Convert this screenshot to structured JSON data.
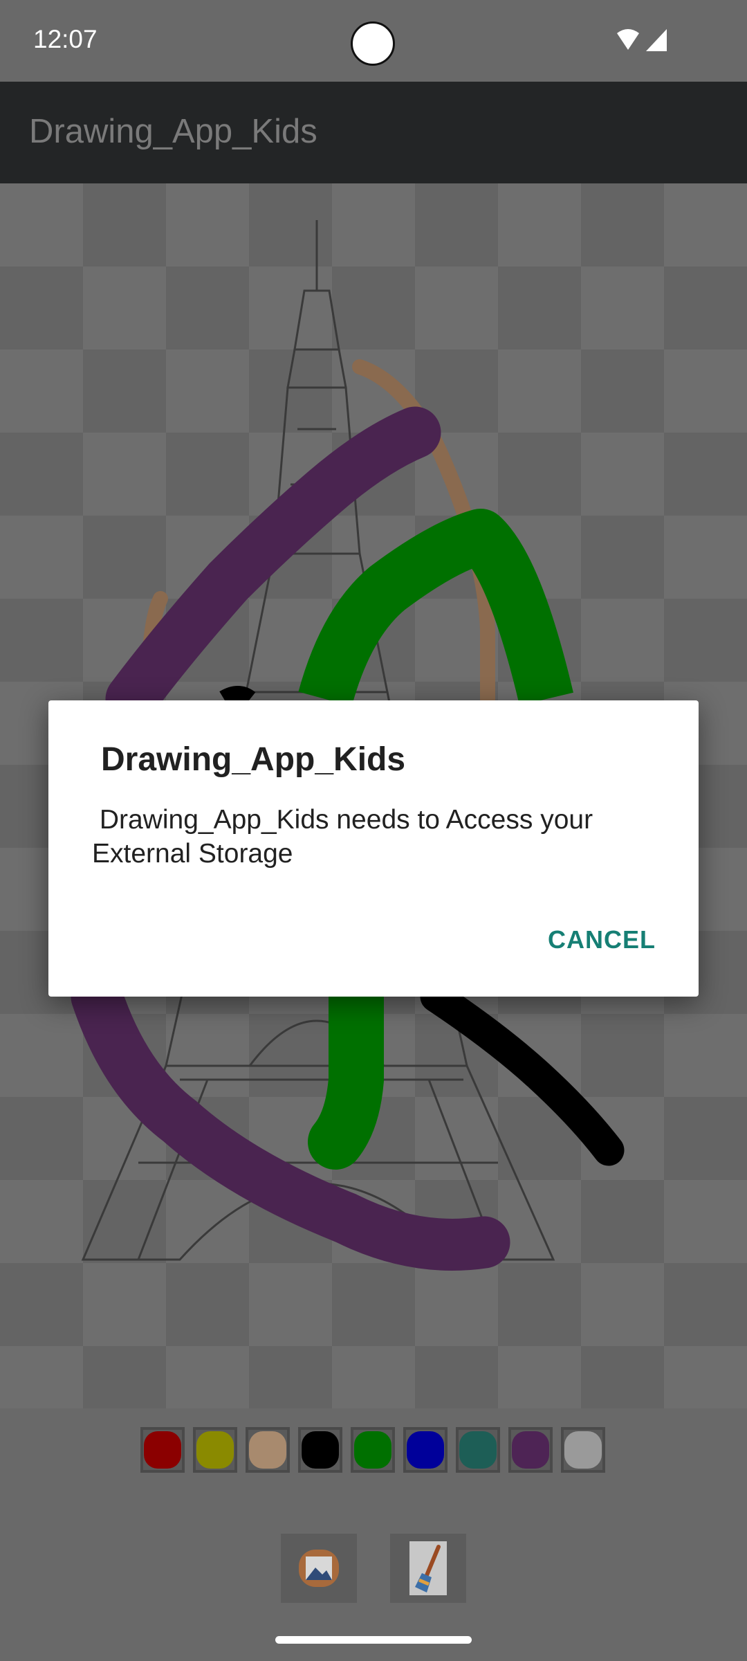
{
  "status_bar": {
    "time": "12:07",
    "icons": [
      "wifi-icon",
      "signal-icon"
    ]
  },
  "app_bar": {
    "title": "Drawing_App_Kids"
  },
  "canvas": {
    "background_image": "eiffel-tower-sketch",
    "strokes": [
      {
        "color": "#8a6a4f",
        "label": "brown stroke"
      },
      {
        "color": "#4a2450",
        "label": "purple stroke"
      },
      {
        "color": "#007000",
        "label": "green stroke"
      },
      {
        "color": "#000000",
        "label": "black stroke"
      }
    ]
  },
  "palette": {
    "colors": [
      {
        "name": "red",
        "hex": "#8b0000"
      },
      {
        "name": "olive",
        "hex": "#8a8a00"
      },
      {
        "name": "tan",
        "hex": "#a88a6e"
      },
      {
        "name": "black",
        "hex": "#000000"
      },
      {
        "name": "green",
        "hex": "#007000"
      },
      {
        "name": "blue",
        "hex": "#00009a"
      },
      {
        "name": "teal",
        "hex": "#1d5e56"
      },
      {
        "name": "purple",
        "hex": "#4e2455"
      },
      {
        "name": "white",
        "hex": "#9a9a9a"
      }
    ]
  },
  "toolbar": {
    "gallery_icon": "image-gallery-icon",
    "brush_icon": "paint-brush-icon"
  },
  "dialog": {
    "title": "Drawing_App_Kids",
    "message": " Drawing_App_Kids needs to Access your External Storage",
    "cancel_label": "CANCEL"
  },
  "colors": {
    "accent": "#167f74",
    "app_bar": "#232526",
    "scrim": "#696969"
  }
}
